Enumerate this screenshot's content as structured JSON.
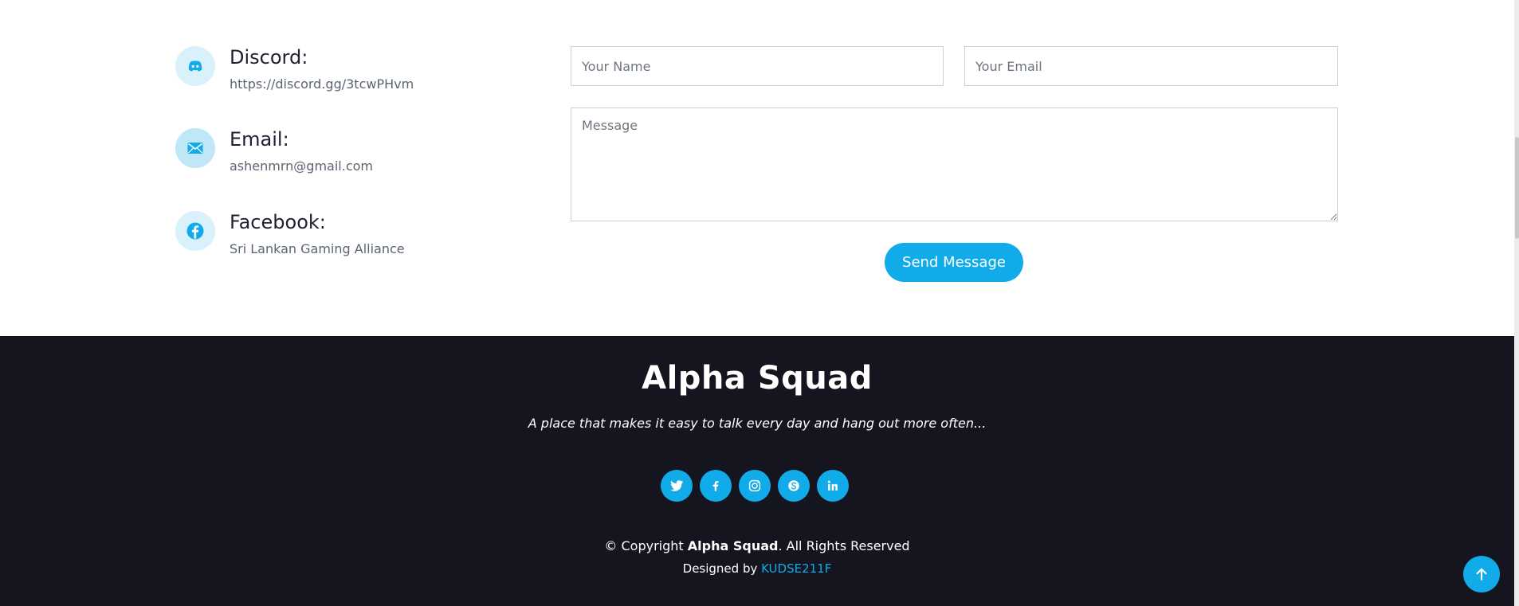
{
  "contact": {
    "items": [
      {
        "icon": "discord-icon",
        "title": "Discord:",
        "text": "https://discord.gg/3tcwPHvm"
      },
      {
        "icon": "mail-icon",
        "title": "Email:",
        "text": "ashenmrn@gmail.com"
      },
      {
        "icon": "facebook-icon",
        "title": "Facebook:",
        "text": "Sri Lankan Gaming Alliance"
      }
    ],
    "form": {
      "name_placeholder": "Your Name",
      "email_placeholder": "Your Email",
      "message_placeholder": "Message",
      "name_value": "",
      "email_value": "",
      "message_value": "",
      "send_label": "Send Message"
    }
  },
  "footer": {
    "brand": "Alpha Squad",
    "tagline": "A place that makes it easy to talk every day and hang out more often...",
    "socials": [
      "twitter-icon",
      "facebook-icon",
      "instagram-icon",
      "skype-icon",
      "linkedin-icon"
    ],
    "copyright_prefix": "© Copyright ",
    "copyright_brand": "Alpha Squad",
    "copyright_suffix": ". All Rights Reserved",
    "designed_by_label": "Designed by ",
    "designer": "KUDSE211F"
  },
  "colors": {
    "accent": "#12abea",
    "footer_bg": "#14151f",
    "icon_bg": "#d8f1fb",
    "heading": "#1d2032"
  }
}
